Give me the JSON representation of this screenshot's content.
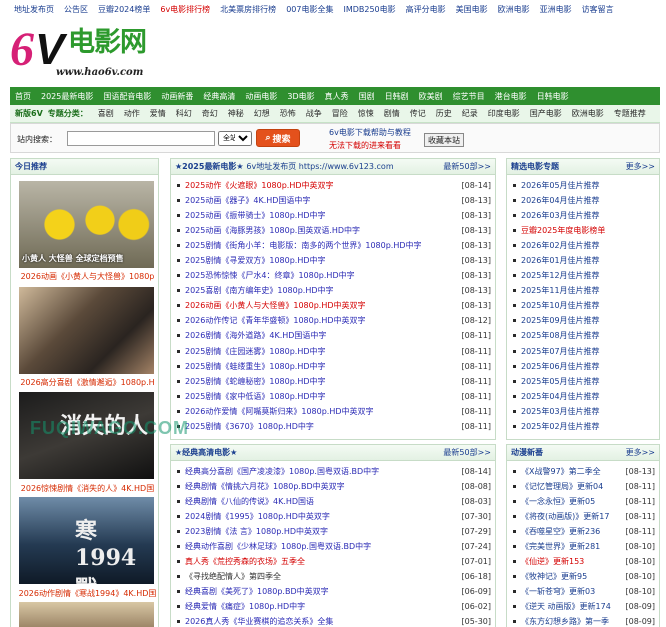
{
  "topnav": [
    "地址发布页",
    "公告区",
    "豆瓣2024榜单",
    "6v电影排行榜",
    "北美票房排行榜",
    "007电影全集",
    "IMDB250电影",
    "高评分电影",
    "美国电影",
    "欧洲电影",
    "亚洲电影",
    "访客留言"
  ],
  "topnav_red_index": 3,
  "logo": {
    "brand": "6V",
    "name": "电影网",
    "url": "www.hao6v.com"
  },
  "nav1": [
    "首页",
    "2025最新电影",
    "国语配音电影",
    "动画新番",
    "经典高清",
    "动画电影",
    "3D电影",
    "真人秀",
    "国剧",
    "日韩剧",
    "欧美剧",
    "综艺节目",
    "港台电影",
    "日韩电影"
  ],
  "nav2_label": "新版6V",
  "nav2_label2": "专题分类：",
  "nav2": [
    "喜剧",
    "动作",
    "爱情",
    "科幻",
    "奇幻",
    "神秘",
    "幻想",
    "恐怖",
    "战争",
    "冒险",
    "惊悚",
    "剧情",
    "传记",
    "历史",
    "纪录",
    "印度电影",
    "国产电影",
    "欧洲电影",
    "专题推荐"
  ],
  "search": {
    "label": "站内搜索：",
    "placeholder": "",
    "select": "全站",
    "button": "搜索",
    "help1": "6v电影下载帮助与教程",
    "help2": "无法下载的进来看看",
    "fav": "收藏本站"
  },
  "left": {
    "title": "今日推荐",
    "posters": [
      {
        "caption": "2026动画《小黄人与大怪兽》1080p",
        "overlay": "小黄人 大怪兽 全球定档预售"
      },
      {
        "caption": "2026高分喜剧《激情邂逅》1080p.H",
        "overlay": ""
      },
      {
        "caption": "2026惊悚剧情《消失的人》4K.HD国",
        "overlay": "消失的人"
      },
      {
        "caption": "2026动作剧情《寒战1994》4K.HD国",
        "overlay": "寒 1994 戰"
      }
    ]
  },
  "mid": {
    "title": "★2025最新电影★",
    "subtitle": "6v地址发布页 https://www.6v123.com",
    "more": "最新50部>>",
    "items": [
      {
        "t": "2025动作《火遮眼》1080p.HD中英双字",
        "d": "[08-14]",
        "c": "red"
      },
      {
        "t": "2025动画《器子》4K.HD国语中字",
        "d": "[08-13]",
        "c": ""
      },
      {
        "t": "2025动画《振带骑士》1080p.HD中字",
        "d": "[08-13]",
        "c": ""
      },
      {
        "t": "2025动画《海豚男孩》1080p.国英双语.HD中字",
        "d": "[08-13]",
        "c": ""
      },
      {
        "t": "2025剧情《街角小羊：电影版：南多的两个世界》1080p.HD中字",
        "d": "[08-13]",
        "c": ""
      },
      {
        "t": "2025剧情《寻爱双方》1080p.HD中字",
        "d": "[08-13]",
        "c": ""
      },
      {
        "t": "2025恐怖惊悚《尸水4：终章》1080p.HD中字",
        "d": "[08-13]",
        "c": ""
      },
      {
        "t": "2025喜剧《南方编年史》1080p.HD中字",
        "d": "[08-13]",
        "c": ""
      },
      {
        "t": "2026动画《小黄人与大怪兽》1080p.HD中英双字",
        "d": "[08-13]",
        "c": "red"
      },
      {
        "t": "2026动作传记《青年华盛顿》1080p.HD中英双字",
        "d": "[08-12]",
        "c": ""
      },
      {
        "t": "2026剧情《海外道路》4K.HD国语中字",
        "d": "[08-11]",
        "c": ""
      },
      {
        "t": "2025剧情《庄园迷雾》1080p.HD中字",
        "d": "[08-11]",
        "c": ""
      },
      {
        "t": "2025剧情《蛙缕重生》1080p.HD中字",
        "d": "[08-11]",
        "c": ""
      },
      {
        "t": "2025剧情《蛇缠秘密》1080p.HD中字",
        "d": "[08-11]",
        "c": ""
      },
      {
        "t": "2025剧情《家中低语》1080p.HD中字",
        "d": "[08-11]",
        "c": ""
      },
      {
        "t": "2026动作爱情《阿嘴莫斯归来》1080p.HD中英双字",
        "d": "[08-11]",
        "c": ""
      },
      {
        "t": "2025剧情《3670》1080p.HD中字",
        "d": "[08-11]",
        "c": ""
      }
    ]
  },
  "mid2": {
    "title": "★经典高清电影★",
    "more": "最新50部>>",
    "items": [
      {
        "t": "经典高分喜剧《国产凌凌漆》1080p.国粤双语.BD中字",
        "d": "[08-14]",
        "c": ""
      },
      {
        "t": "经典剧情《情挑六月花》1080p.BD中英双字",
        "d": "[08-08]",
        "c": ""
      },
      {
        "t": "经典剧情《八仙的传说》4K.HD国语",
        "d": "[08-03]",
        "c": ""
      },
      {
        "t": "2024剧情《1995》1080p.HD中英双字",
        "d": "[07-30]",
        "c": ""
      },
      {
        "t": "2023剧情《法 言》1080p.HD中英双字",
        "d": "[07-29]",
        "c": ""
      },
      {
        "t": "经典动作喜剧《少林足球》1080p.国粤双语.BD中字",
        "d": "[07-24]",
        "c": ""
      },
      {
        "t": "真人秀《荒控秀森的衣场》五季全",
        "d": "[07-01]",
        "c": "red"
      },
      {
        "t": "《寻找绝配情人》第四季全",
        "d": "[06-18]",
        "c": "dk"
      },
      {
        "t": "经典喜剧《美死了》1080p.BD中英双字",
        "d": "[06-09]",
        "c": ""
      },
      {
        "t": "经典爱情《痛症》1080p.HD中字",
        "d": "[06-02]",
        "c": ""
      },
      {
        "t": "2026真人秀《华业赛棋的追恋关系》全集",
        "d": "[05-30]",
        "c": ""
      }
    ]
  },
  "right": {
    "title": "精选电影专题",
    "more": "更多>>",
    "items": [
      {
        "t": "2026年05月佳片推荐",
        "c": ""
      },
      {
        "t": "2026年04月佳片推荐",
        "c": ""
      },
      {
        "t": "2026年03月佳片推荐",
        "c": ""
      },
      {
        "t": "豆瓣2025年度电影榜单",
        "c": "red"
      },
      {
        "t": "2026年02月佳片推荐",
        "c": ""
      },
      {
        "t": "2026年01月佳片推荐",
        "c": ""
      },
      {
        "t": "2025年12月佳片推荐",
        "c": ""
      },
      {
        "t": "2025年11月佳片推荐",
        "c": ""
      },
      {
        "t": "2025年10月佳片推荐",
        "c": ""
      },
      {
        "t": "2025年09月佳片推荐",
        "c": ""
      },
      {
        "t": "2025年08月佳片推荐",
        "c": ""
      },
      {
        "t": "2025年07月佳片推荐",
        "c": ""
      },
      {
        "t": "2025年06月佳片推荐",
        "c": ""
      },
      {
        "t": "2025年05月佳片推荐",
        "c": ""
      },
      {
        "t": "2025年04月佳片推荐",
        "c": ""
      },
      {
        "t": "2025年03月佳片推荐",
        "c": ""
      },
      {
        "t": "2025年02月佳片推荐",
        "c": ""
      }
    ]
  },
  "right2": {
    "title": "动漫新番",
    "more": "更多>>",
    "items": [
      {
        "t": "《X战警97》第二季全",
        "d": "[08-13]",
        "c": ""
      },
      {
        "t": "《记忆管理局》更新04",
        "d": "[08-11]",
        "c": ""
      },
      {
        "t": "《一念永恒》更新05",
        "d": "[08-11]",
        "c": ""
      },
      {
        "t": "《将夜(动画版)》更新17",
        "d": "[08-11]",
        "c": ""
      },
      {
        "t": "《吞噬星空》更新236",
        "d": "[08-11]",
        "c": ""
      },
      {
        "t": "《完美世界》更新281",
        "d": "[08-10]",
        "c": ""
      },
      {
        "t": "《仙逆》更新153",
        "d": "[08-10]",
        "c": "red"
      },
      {
        "t": "《牧神记》更新95",
        "d": "[08-10]",
        "c": ""
      },
      {
        "t": "《一斩苍穹》更新03",
        "d": "[08-10]",
        "c": ""
      },
      {
        "t": "《逆天 动画版》更新174",
        "d": "[08-09]",
        "c": ""
      },
      {
        "t": "《东方幻想乡路》第一季",
        "d": "[08-09]",
        "c": ""
      }
    ]
  },
  "watermark": "FUQIWAGO.COM"
}
